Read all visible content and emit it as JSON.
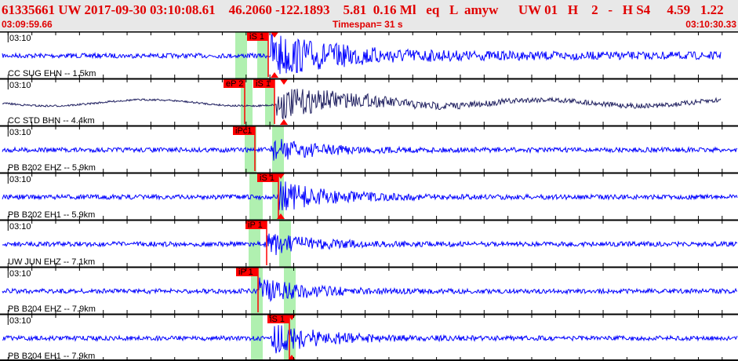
{
  "header": {
    "title": "61335661 UW 2017-09-30 03:10:08.61    46.2060 -122.1893    5.81  0.16 Ml   eq   L  amyw      UW 01   H    2   -   H S4     4.59   1.22",
    "start_time": "03:09:59.66",
    "timespan": "Timespan=  31 s",
    "end_time": "03:10:30.33"
  },
  "colors": {
    "header_text": "#e00000",
    "trace": "#0000ff",
    "trace_alt": "#202060",
    "pick": "#ff0000",
    "window": "#b0f0b0"
  },
  "panels": [
    {
      "time_label": "03:10",
      "channel": "CC SUG EHN -- 1.5km",
      "picks": [
        {
          "label": "iS 1"
        }
      ]
    },
    {
      "time_label": "03:10",
      "channel": "CC STD BHN -- 4.4km",
      "picks": [
        {
          "label": "eP 2"
        },
        {
          "label": "iS 1"
        }
      ]
    },
    {
      "time_label": "03:10",
      "channel": "PB B202 EHZ -- 5.9km",
      "picks": [
        {
          "label": "iPc1"
        }
      ]
    },
    {
      "time_label": "03:10",
      "channel": "PB B202 EH1 -- 5.9km",
      "picks": [
        {
          "label": "iS 1"
        }
      ]
    },
    {
      "time_label": "03:10",
      "channel": "UW JUN EHZ -- 7.1km",
      "picks": [
        {
          "label": "iP 1"
        }
      ]
    },
    {
      "time_label": "03:10",
      "channel": "PB B204 EHZ -- 7.9km",
      "picks": [
        {
          "label": "iP 1"
        }
      ]
    },
    {
      "time_label": "03:10",
      "channel": "PB B204 EH1 -- 7.9km",
      "picks": [
        {
          "label": "iS 1"
        }
      ]
    }
  ]
}
